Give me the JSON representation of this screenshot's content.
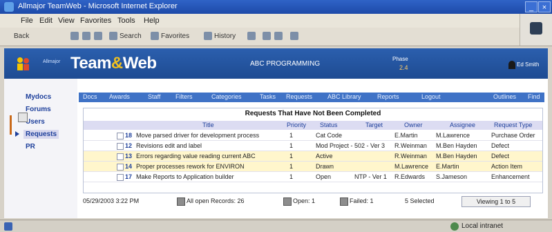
{
  "window": {
    "title": "Allmajor TeamWeb - Microsoft Internet Explorer",
    "min": "_",
    "close": "×"
  },
  "menu": [
    "File",
    "Edit",
    "View",
    "Favorites",
    "Tools",
    "Help"
  ],
  "toolbar": {
    "back": "Back",
    "search": "Search",
    "favorites": "Favorites",
    "history": "History"
  },
  "banner": {
    "micro_brand": "Allmajor",
    "brand_main": "Team",
    "brand_amp": "&",
    "brand_end": "Web",
    "program": "ABC PROGRAMMING",
    "phase_label": "Phase",
    "phase_value": "2.4",
    "user": "Ed Smith"
  },
  "sidebar": [
    "Mydocs",
    "Forums",
    "Users",
    "Requests",
    "PR"
  ],
  "nav": [
    "Docs",
    "Awards",
    "Staff",
    "Filters",
    "Categories",
    "Tasks",
    "Requests",
    "ABC Library",
    "Reports",
    "Logout",
    "Outlines",
    "Find"
  ],
  "table": {
    "title": "Requests That Have Not Been Completed",
    "headers": [
      "Title",
      "Priority",
      "Status",
      "Target",
      "Owner",
      "Assignee",
      "Request Type"
    ],
    "rows": [
      {
        "num": "18",
        "title": "Move parsed driver for development process",
        "priority": "1",
        "status": "Cat Code",
        "target": "",
        "owner": "E.Martin",
        "assignee": "M.Lawrence",
        "type": "Purchase Order"
      },
      {
        "num": "12",
        "title": "Revisions edit and label",
        "priority": "1",
        "status": "Mod Project - 502 - Ver 3",
        "target": "",
        "owner": "R.Weinman",
        "assignee": "M.Ben Hayden",
        "type": "Defect"
      },
      {
        "num": "13",
        "title": "Errors regarding value reading current ABC",
        "priority": "1",
        "status": "Active",
        "target": "",
        "owner": "R.Weinman",
        "assignee": "M.Ben Hayden",
        "type": "Defect"
      },
      {
        "num": "14",
        "title": "Proper processes rework for ENVIRON",
        "priority": "1",
        "status": "Drawn",
        "target": "",
        "owner": "M.Lawrence",
        "assignee": "E.Martin",
        "type": "Action Item"
      },
      {
        "num": "17",
        "title": "Make Reports to Application builder",
        "priority": "1",
        "status": "Open",
        "target": "NTP - Ver 1",
        "owner": "R.Edwards",
        "assignee": "S.Jameson",
        "type": "Enhancement"
      }
    ]
  },
  "footer": {
    "datetime": "05/29/2003 3:22 PM",
    "records": "All open Records: 26",
    "open": "Open: 1",
    "failed": "Failed: 1",
    "selected": "5 Selected",
    "view": "Viewing 1 to 5"
  },
  "status": {
    "zone": "Local intranet"
  }
}
